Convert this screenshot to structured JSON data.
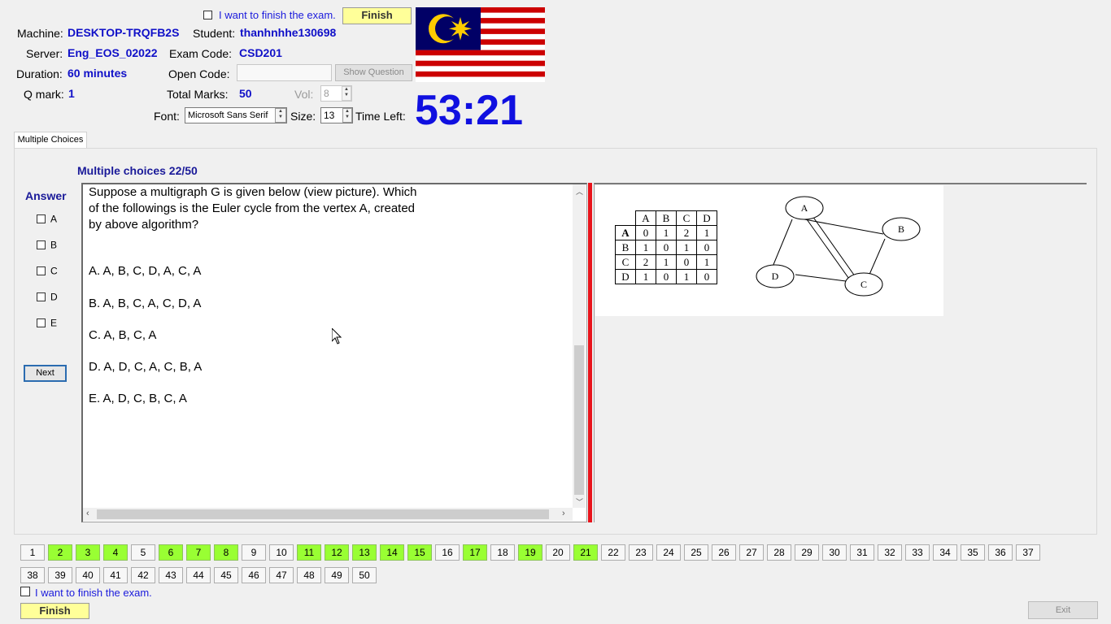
{
  "header": {
    "finish_checkbox_label": "I want to finish the exam.",
    "finish_button": "Finish",
    "machine_label": "Machine:",
    "machine_value": "DESKTOP-TRQFB2S",
    "student_label": "Student:",
    "student_value": "thanhnhhe130698",
    "server_label": "Server:",
    "server_value": "Eng_EOS_02022",
    "exam_code_label": "Exam Code:",
    "exam_code_value": "CSD201",
    "duration_label": "Duration:",
    "duration_value": "60 minutes",
    "open_code_label": "Open Code:",
    "open_code_value": "",
    "show_question_button": "Show Question",
    "qmark_label": "Q mark:",
    "qmark_value": "1",
    "total_marks_label": "Total Marks:",
    "total_marks_value": "50",
    "vol_label": "Vol:",
    "vol_value": "8",
    "font_label": "Font:",
    "font_value": "Microsoft Sans Serif",
    "size_label": "Size:",
    "size_value": "13",
    "time_left_label": "Time Left:",
    "time_left_value": "53:21"
  },
  "tab": {
    "label": "Multiple Choices"
  },
  "question": {
    "counter": "Multiple choices 22/50",
    "text_lines": [
      "Suppose a multigraph G is given below (view picture). Which",
      "of the followings is the Euler cycle from the vertex  A, created",
      "by above algorithm?"
    ],
    "options": [
      "A.  A, B, C, D, A, C, A",
      "B.  A, B, C, A, C, D, A",
      "C.  A, B, C, A",
      "D.  A, D, C, A, C, B, A",
      "E.  A, D, C, B, C, A"
    ]
  },
  "answer_panel": {
    "title": "Answer",
    "choices": [
      "A",
      "B",
      "C",
      "D",
      "E"
    ],
    "next_button": "Next"
  },
  "picture": {
    "matrix_headers": [
      "A",
      "B",
      "C",
      "D"
    ],
    "matrix_rows": [
      {
        "label": "A",
        "cells": [
          "0",
          "1",
          "2",
          "1"
        ]
      },
      {
        "label": "B",
        "cells": [
          "1",
          "0",
          "1",
          "0"
        ]
      },
      {
        "label": "C",
        "cells": [
          "2",
          "1",
          "0",
          "1"
        ]
      },
      {
        "label": "D",
        "cells": [
          "1",
          "0",
          "1",
          "0"
        ]
      }
    ],
    "graph_nodes": [
      "A",
      "B",
      "C",
      "D"
    ]
  },
  "navigation": {
    "answered_color": "#99ff33",
    "questions_row1": [
      "1",
      "2",
      "3",
      "4",
      "5",
      "6",
      "7",
      "8",
      "9",
      "10",
      "11",
      "12",
      "13",
      "14",
      "15",
      "16",
      "17",
      "18",
      "19",
      "20",
      "21",
      "22",
      "23",
      "24",
      "25",
      "26",
      "27",
      "28",
      "29",
      "30",
      "31",
      "32",
      "33",
      "34",
      "35",
      "36",
      "37"
    ],
    "questions_row2": [
      "38",
      "39",
      "40",
      "41",
      "42",
      "43",
      "44",
      "45",
      "46",
      "47",
      "48",
      "49",
      "50"
    ],
    "answered": [
      "2",
      "3",
      "4",
      "6",
      "7",
      "8",
      "11",
      "12",
      "13",
      "14",
      "15",
      "17",
      "19",
      "21"
    ]
  },
  "footer": {
    "finish_checkbox_label": "I want to finish the exam.",
    "finish_button": "Finish",
    "exit_button": "Exit"
  },
  "icons": {
    "flag": "malaysia-flag-icon",
    "cursor": "mouse-pointer-icon"
  }
}
